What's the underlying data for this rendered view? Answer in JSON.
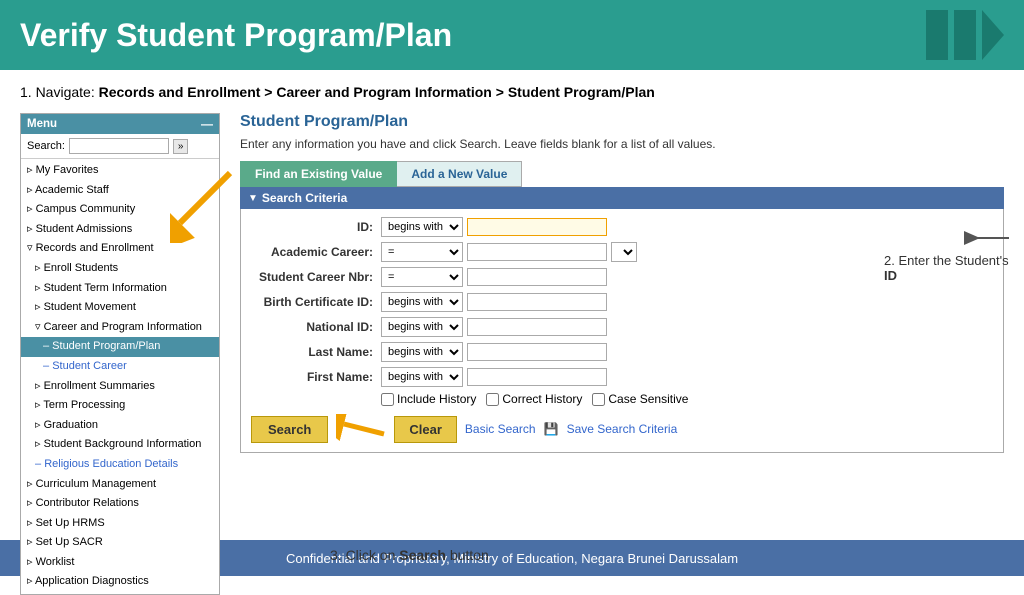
{
  "header": {
    "title": "Verify Student Program/Plan",
    "shapes": [
      "rect1",
      "rect2",
      "triangle"
    ]
  },
  "nav": {
    "step1_prefix": "1. Navigate: ",
    "step1_bold": "Records and Enrollment > Career and Program Information > Student Program/Plan"
  },
  "menu": {
    "title": "Menu",
    "search_label": "Search:",
    "search_placeholder": "",
    "items": [
      {
        "label": "My Favorites",
        "level": 1,
        "type": "expand"
      },
      {
        "label": "Academic Staff",
        "level": 1,
        "type": "expand"
      },
      {
        "label": "Campus Community",
        "level": 1,
        "type": "expand"
      },
      {
        "label": "Student Admissions",
        "level": 1,
        "type": "expand"
      },
      {
        "label": "Records and Enrollment",
        "level": 1,
        "type": "expand-open"
      },
      {
        "label": "Enroll Students",
        "level": 2,
        "type": "expand"
      },
      {
        "label": "Student Term Information",
        "level": 2,
        "type": "expand"
      },
      {
        "label": "Student Movement",
        "level": 2,
        "type": "expand"
      },
      {
        "label": "Career and Program Information",
        "level": 2,
        "type": "expand-open"
      },
      {
        "label": "Student Program/Plan",
        "level": 3,
        "type": "active"
      },
      {
        "label": "Student Career",
        "level": 3,
        "type": "link"
      },
      {
        "label": "Enrollment Summaries",
        "level": 2,
        "type": "expand"
      },
      {
        "label": "Term Processing",
        "level": 2,
        "type": "expand"
      },
      {
        "label": "Graduation",
        "level": 2,
        "type": "expand"
      },
      {
        "label": "Student Background Information",
        "level": 2,
        "type": "expand"
      },
      {
        "label": "Religious Education Details",
        "level": 2,
        "type": "link"
      },
      {
        "label": "Curriculum Management",
        "level": 1,
        "type": "expand"
      },
      {
        "label": "Contributor Relations",
        "level": 1,
        "type": "expand"
      },
      {
        "label": "Set Up HRMS",
        "level": 1,
        "type": "expand"
      },
      {
        "label": "Set Up SACR",
        "level": 1,
        "type": "expand"
      },
      {
        "label": "Worklist",
        "level": 1,
        "type": "expand"
      },
      {
        "label": "Application Diagnostics",
        "level": 1,
        "type": "expand"
      }
    ]
  },
  "panel": {
    "title": "Student Program/Plan",
    "description": "Enter any information you have and click Search. Leave fields blank for a list of all values.",
    "tab_find": "Find an Existing Value",
    "tab_add": "Add a New Value",
    "search_criteria_label": "Search Criteria",
    "fields": [
      {
        "label": "ID:",
        "operator": "begins with",
        "value": ""
      },
      {
        "label": "Academic Career:",
        "operator": "=",
        "value": "",
        "has_right_dropdown": true
      },
      {
        "label": "Student Career Nbr:",
        "operator": "=",
        "value": ""
      },
      {
        "label": "Birth Certificate ID:",
        "operator": "begins with",
        "value": ""
      },
      {
        "label": "National ID:",
        "operator": "begins with",
        "value": ""
      },
      {
        "label": "Last Name:",
        "operator": "begins with",
        "value": ""
      },
      {
        "label": "First Name:",
        "operator": "begins with",
        "value": ""
      }
    ],
    "checkboxes": [
      {
        "label": "Include History"
      },
      {
        "label": "Correct History"
      },
      {
        "label": "Case Sensitive"
      }
    ],
    "btn_search": "Search",
    "btn_clear": "Clear",
    "btn_basic_search": "Basic Search",
    "btn_save_criteria": "Save Search Criteria"
  },
  "annotations": {
    "step2": "2. Enter the Student's ID",
    "step3": "3. Click on Search button"
  },
  "footer": {
    "text": "Confidential and Proprietary, Ministry of Education, Negara Brunei Darussalam"
  }
}
